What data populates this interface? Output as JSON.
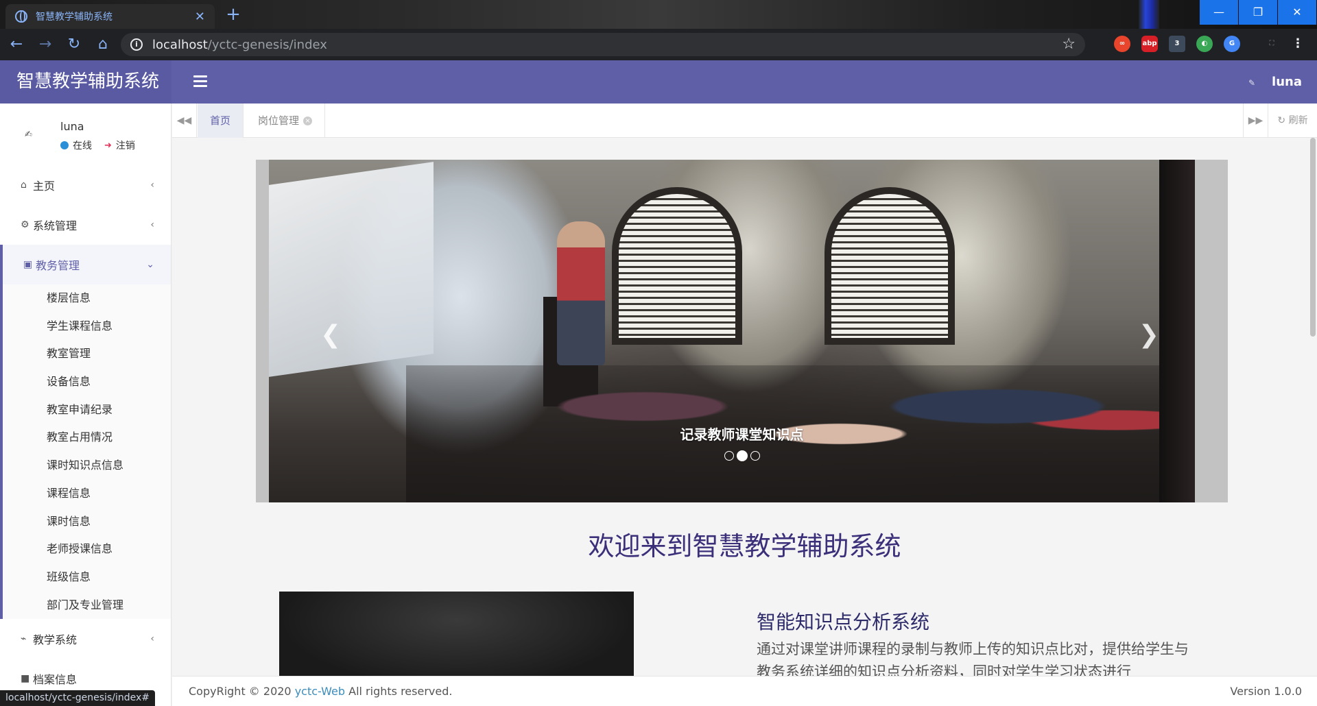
{
  "browser": {
    "tab_title": "智慧教学辅助系统",
    "tab_close": "✕",
    "new_tab": "+",
    "url_host": "localhost",
    "url_path": "/yctc-genesis/index",
    "status_url": "localhost/yctc-genesis/index#",
    "extensions": [
      "abp",
      "3"
    ],
    "window_controls": {
      "minimize": "—",
      "maximize": "❐",
      "close": "✕"
    }
  },
  "header": {
    "brand": "智慧教学辅助系统",
    "user_name": "luna"
  },
  "userpanel": {
    "name": "luna",
    "online": "在线",
    "logout": "注销"
  },
  "sidebar": {
    "items": [
      {
        "label": "主页",
        "icon": "home-icon"
      },
      {
        "label": "系统管理",
        "icon": "gear-icon"
      },
      {
        "label": "教务管理",
        "icon": "book-icon"
      }
    ],
    "sub_items": [
      "楼层信息",
      "学生课程信息",
      "教室管理",
      "设备信息",
      "教室申请纪录",
      "教室占用情况",
      "课时知识点信息",
      "课程信息",
      "课时信息",
      "老师授课信息",
      "班级信息",
      "部门及专业管理"
    ],
    "after": [
      {
        "label": "教学系统",
        "icon": "rss-icon"
      },
      {
        "label": "档案信息",
        "icon": "archive-icon"
      }
    ]
  },
  "content_tabs": {
    "home": "首页",
    "position": "岗位管理",
    "refresh": "刷新"
  },
  "carousel": {
    "caption": "记录教师课堂知识点",
    "slide_count": 3,
    "active_index": 1
  },
  "welcome": "欢迎来到智慧教学辅助系统",
  "feature": {
    "title": "智能知识点分析系统",
    "desc": "通过对课堂讲师课程的录制与教师上传的知识点比对，提供给学生与教务系统详细的知识点分析资料，同时对学生学习状态进行"
  },
  "footer": {
    "copyright_prefix": "CopyRight © 2020 ",
    "link": "yctc-Web",
    "copyright_suffix": " All rights reserved.",
    "version": "Version 1.0.0"
  },
  "colors": {
    "accent": "#5f5fa8",
    "chrome_blue": "#1a73e8"
  }
}
